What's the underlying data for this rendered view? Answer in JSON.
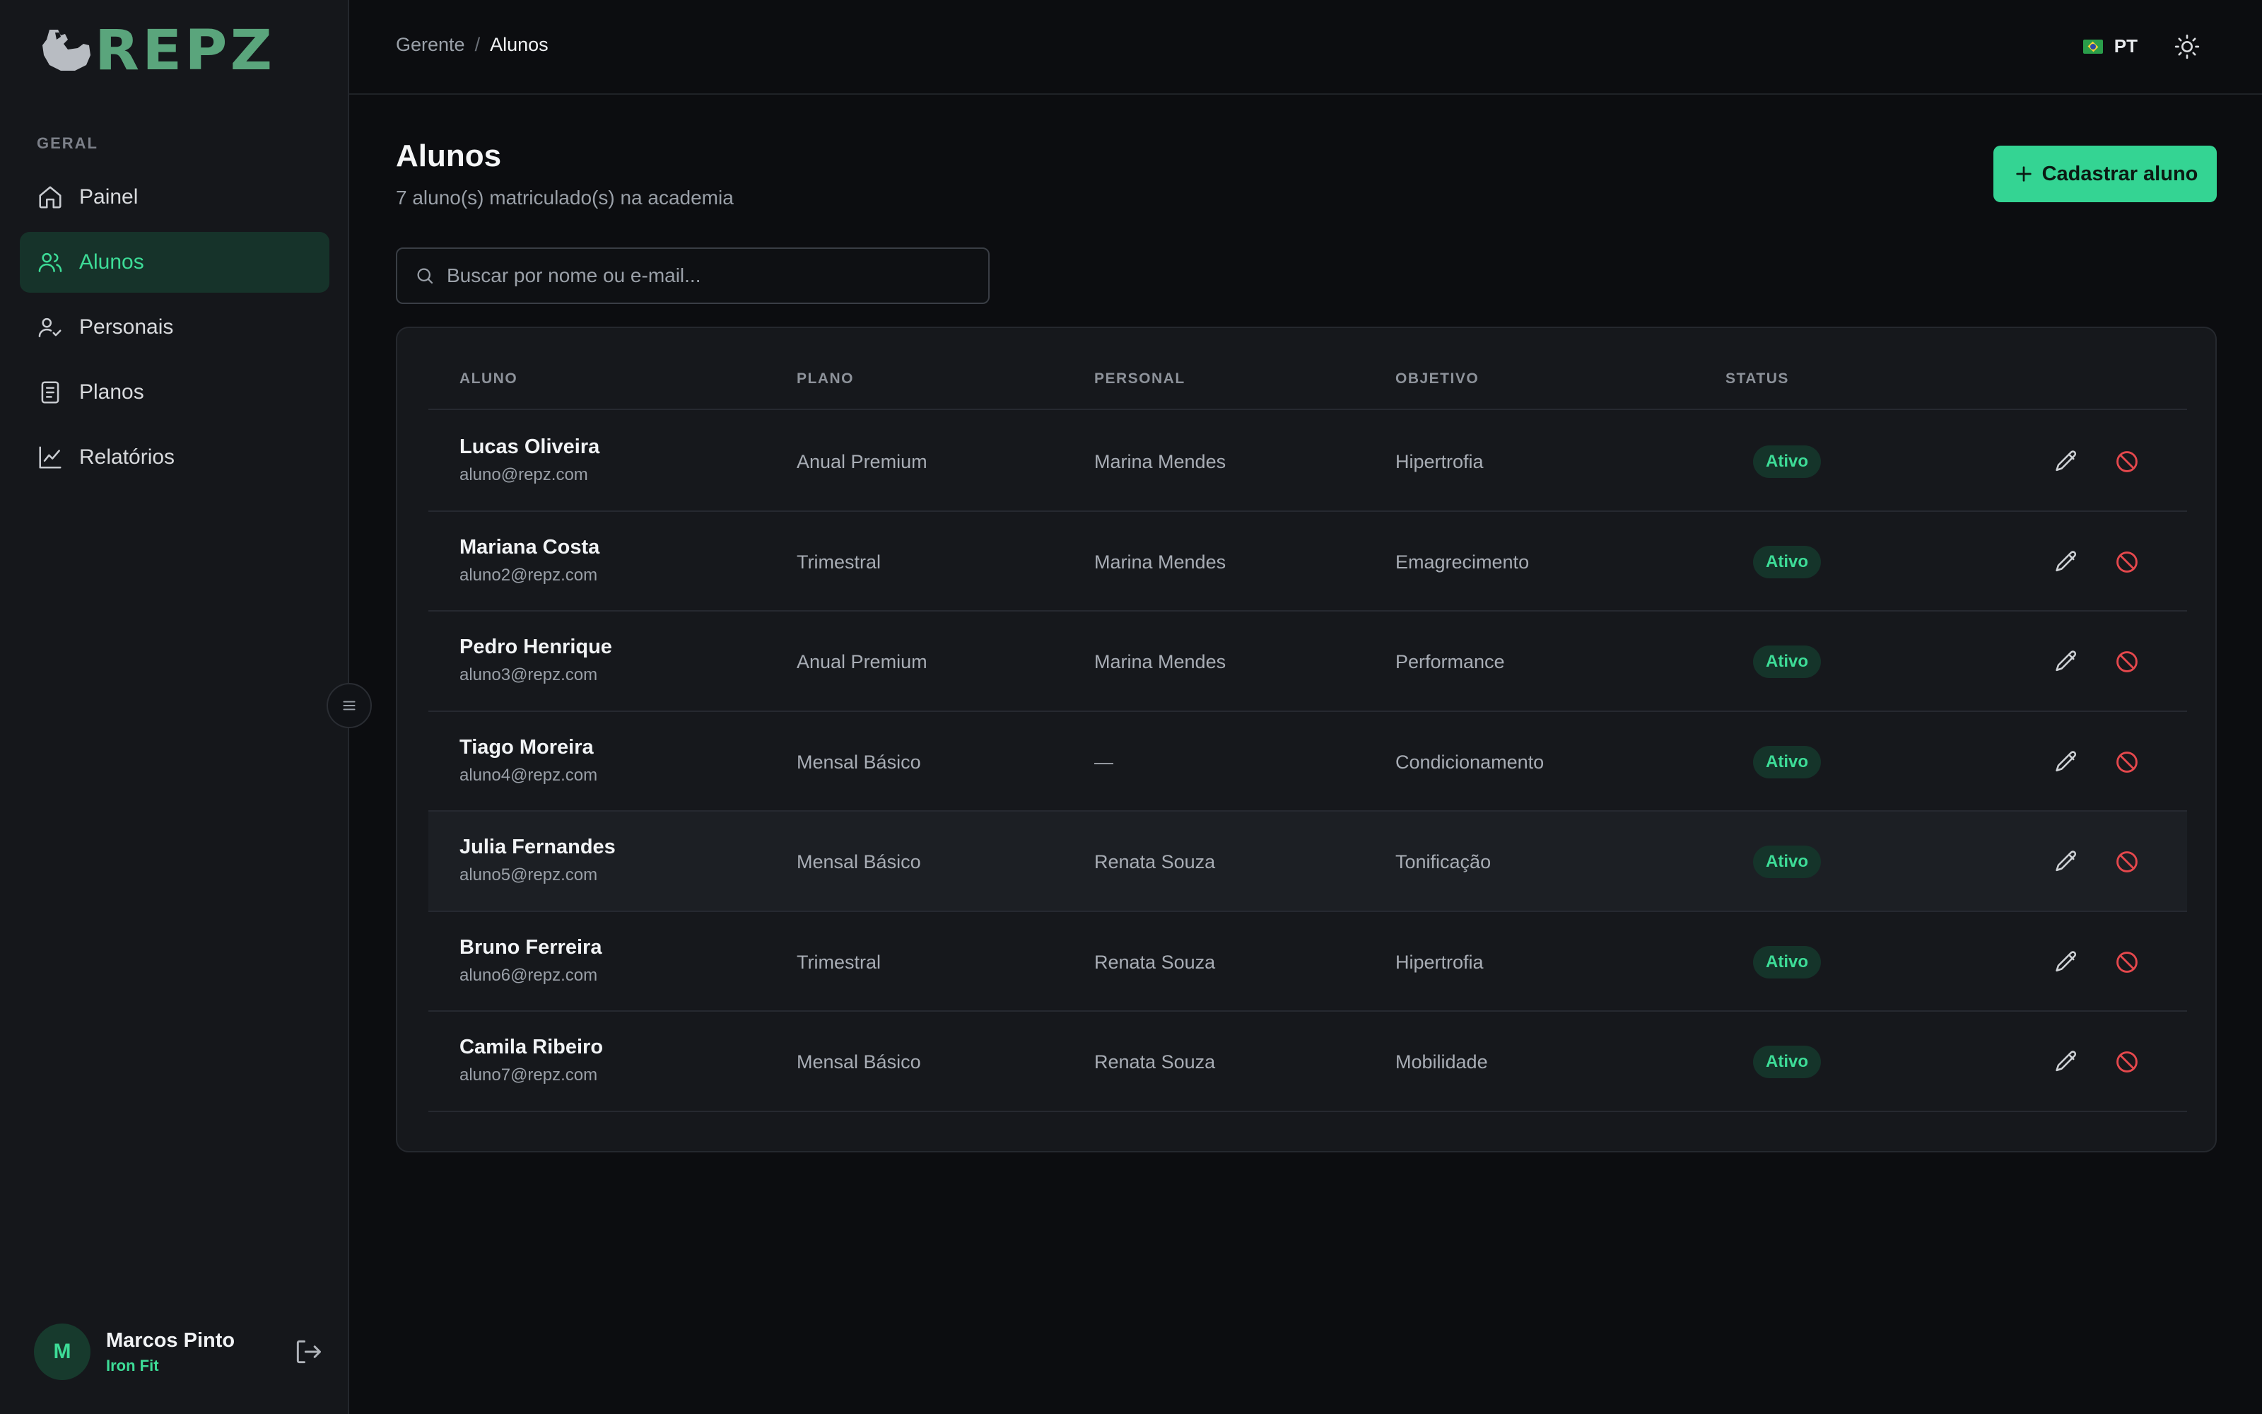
{
  "brand": {
    "logo_text": "REPZ"
  },
  "sidebar": {
    "section_label": "GERAL",
    "items": [
      {
        "label": "Painel",
        "icon": "home-icon"
      },
      {
        "label": "Alunos",
        "icon": "users-icon",
        "active": true
      },
      {
        "label": "Personais",
        "icon": "user-check-icon"
      },
      {
        "label": "Planos",
        "icon": "document-icon"
      },
      {
        "label": "Relatórios",
        "icon": "chart-line-icon"
      }
    ],
    "user": {
      "initial": "M",
      "name": "Marcos Pinto",
      "gym": "Iron Fit"
    }
  },
  "header": {
    "breadcrumb": {
      "parent": "Gerente",
      "separator": "/",
      "current": "Alunos"
    },
    "language": "PT"
  },
  "main": {
    "title": "Alunos",
    "subtitle": "7 aluno(s) matriculado(s) na academia",
    "add_button": "Cadastrar aluno",
    "search_placeholder": "Buscar por nome ou e-mail..."
  },
  "table": {
    "columns": [
      "ALUNO",
      "PLANO",
      "PERSONAL",
      "OBJETIVO",
      "STATUS"
    ],
    "rows": [
      {
        "name": "Lucas Oliveira",
        "email": "aluno@repz.com",
        "plan": "Anual Premium",
        "personal": "Marina Mendes",
        "goal": "Hipertrofia",
        "status": "Ativo"
      },
      {
        "name": "Mariana Costa",
        "email": "aluno2@repz.com",
        "plan": "Trimestral",
        "personal": "Marina Mendes",
        "goal": "Emagrecimento",
        "status": "Ativo"
      },
      {
        "name": "Pedro Henrique",
        "email": "aluno3@repz.com",
        "plan": "Anual Premium",
        "personal": "Marina Mendes",
        "goal": "Performance",
        "status": "Ativo"
      },
      {
        "name": "Tiago Moreira",
        "email": "aluno4@repz.com",
        "plan": "Mensal Básico",
        "personal": "—",
        "goal": "Condicionamento",
        "status": "Ativo"
      },
      {
        "name": "Julia Fernandes",
        "email": "aluno5@repz.com",
        "plan": "Mensal Básico",
        "personal": "Renata Souza",
        "goal": "Tonificação",
        "status": "Ativo"
      },
      {
        "name": "Bruno Ferreira",
        "email": "aluno6@repz.com",
        "plan": "Trimestral",
        "personal": "Renata Souza",
        "goal": "Hipertrofia",
        "status": "Ativo"
      },
      {
        "name": "Camila Ribeiro",
        "email": "aluno7@repz.com",
        "plan": "Mensal Básico",
        "personal": "Renata Souza",
        "goal": "Mobilidade",
        "status": "Ativo"
      }
    ]
  },
  "colors": {
    "accent": "#3ddc97",
    "button": "#34d493",
    "danger": "#e5484d"
  }
}
